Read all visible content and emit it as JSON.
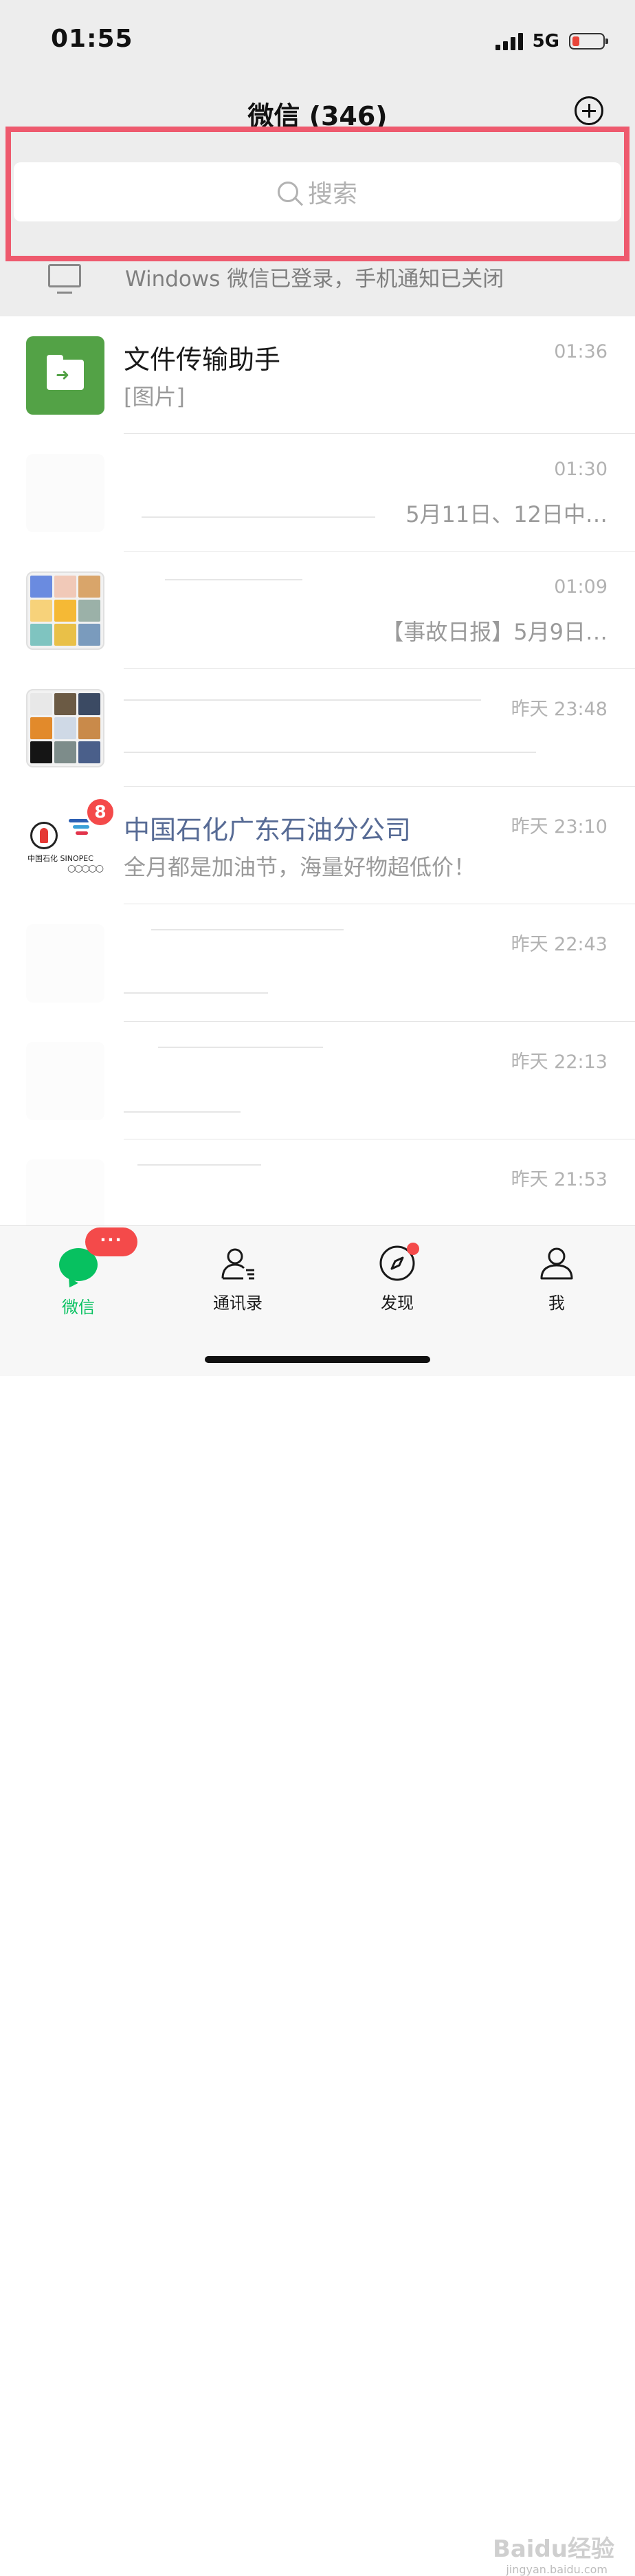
{
  "status_bar": {
    "time": "01:55",
    "network": "5G"
  },
  "header": {
    "title": "微信 (346)"
  },
  "search": {
    "placeholder": "搜索"
  },
  "notice": {
    "text": "Windows 微信已登录，手机通知已关闭"
  },
  "chats": [
    {
      "name": "文件传输助手",
      "preview": "[图片]",
      "time": "01:36"
    },
    {
      "name": "",
      "preview": "5月11日、12日中…",
      "time": "01:30"
    },
    {
      "name": "",
      "preview": "【事故日报】5月9日…",
      "time": "01:09"
    },
    {
      "name": "",
      "preview": "",
      "time": "昨天 23:48"
    },
    {
      "name": "中国石化广东石油分公司",
      "preview": "全月都是加油节，海量好物超低价！",
      "time": "昨天 23:10",
      "badge": "8",
      "logo_text": "中国石化 SINOPEC",
      "logo_sub": "BEIJING 2022"
    },
    {
      "name": "",
      "preview": "",
      "time": "昨天 22:43"
    },
    {
      "name": "",
      "preview": "",
      "time": "昨天 22:13"
    },
    {
      "name": "",
      "preview": "",
      "time": "昨天 21:53"
    }
  ],
  "tabbar": {
    "chats": "微信",
    "contacts": "通讯录",
    "discover": "发现",
    "me": "我",
    "chats_badge": "···"
  },
  "watermark": {
    "brand": "Baidu经验",
    "url": "jingyan.baidu.com"
  },
  "colors": {
    "accent": "#07c160",
    "badge": "#f44a4a",
    "highlight": "#ee5a6e"
  }
}
